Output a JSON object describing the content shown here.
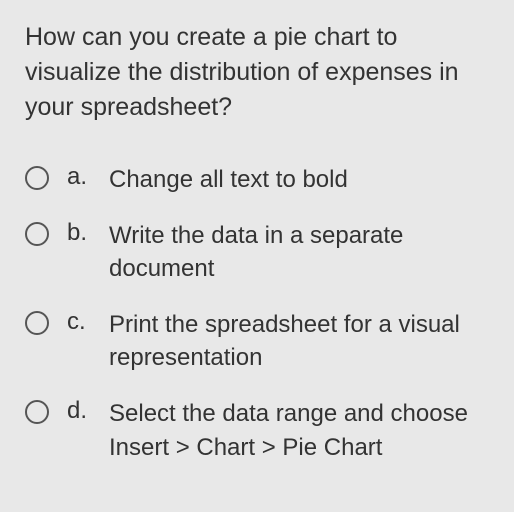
{
  "question": "How can you create a pie chart to visualize the distribution of expenses in your spreadsheet?",
  "options": [
    {
      "letter": "a.",
      "text": "Change all text to bold"
    },
    {
      "letter": "b.",
      "text": "Write the data in a separate document"
    },
    {
      "letter": "c.",
      "text": "Print the spreadsheet for a visual representation"
    },
    {
      "letter": "d.",
      "text": "Select the data range and choose Insert > Chart > Pie Chart"
    }
  ]
}
